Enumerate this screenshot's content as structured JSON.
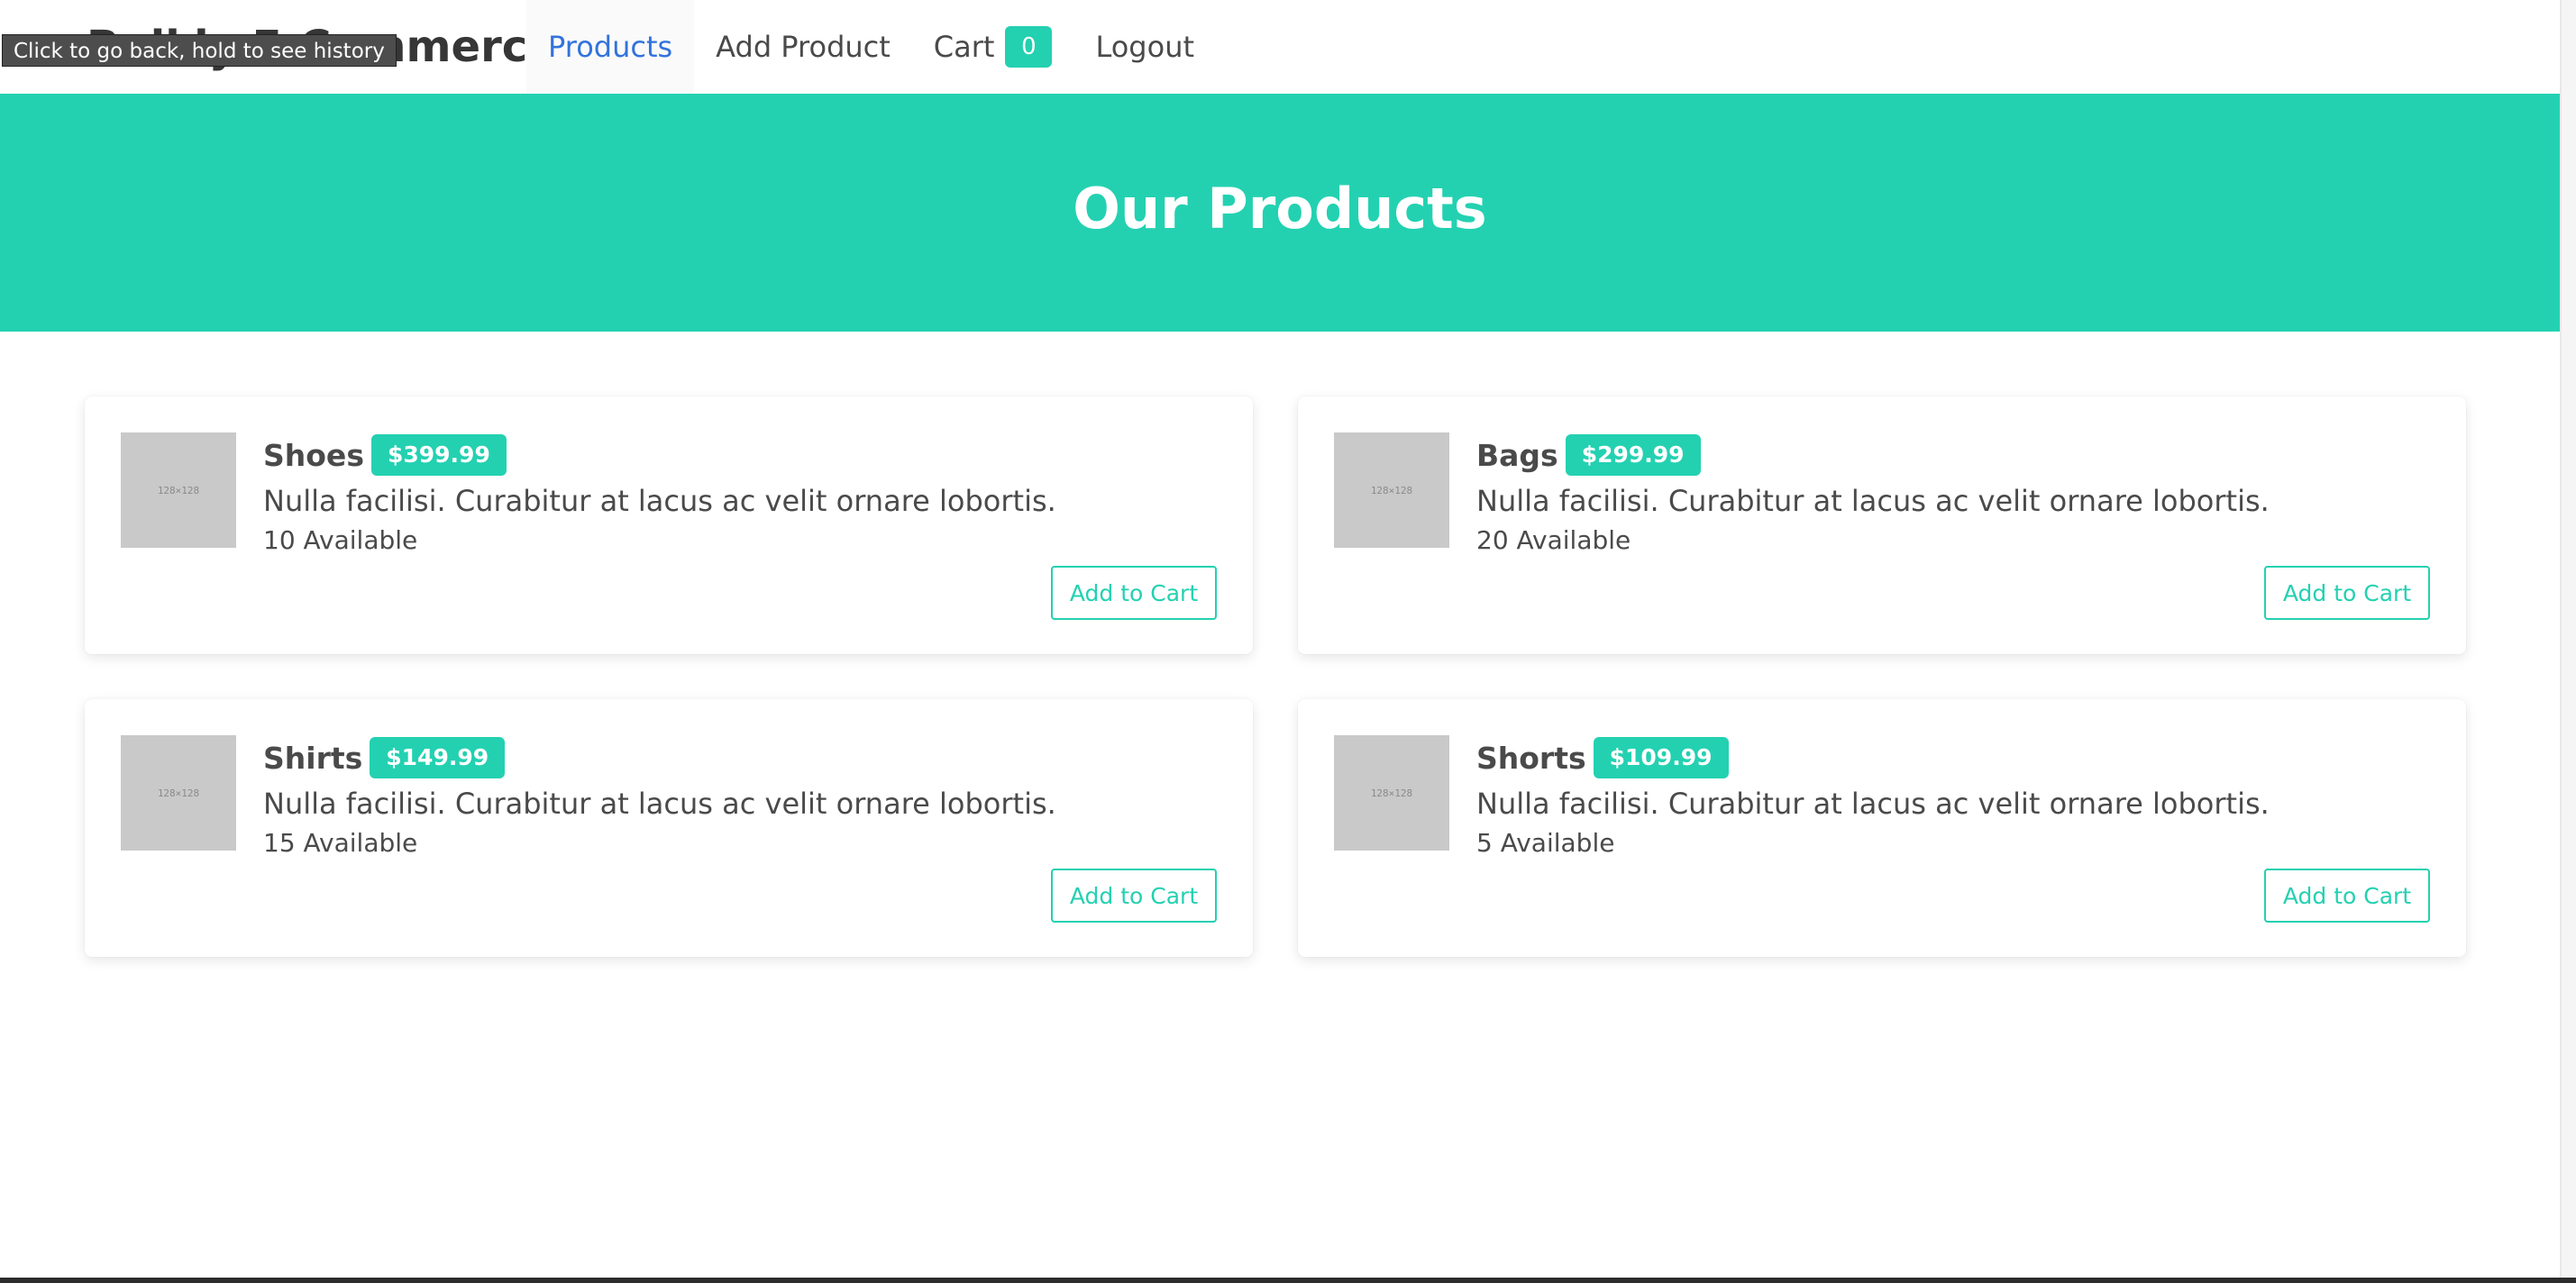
{
  "tooltip": "Click to go back, hold to see history",
  "navbar": {
    "brand": "Bulkly E-Commerce",
    "items": [
      {
        "label": "Products"
      },
      {
        "label": "Add Product"
      },
      {
        "label": "Cart",
        "badge": "0"
      },
      {
        "label": "Logout"
      }
    ]
  },
  "hero": {
    "title": "Our Products"
  },
  "products": [
    {
      "name": "Shoes",
      "price": "$399.99",
      "description": "Nulla facilisi. Curabitur at lacus ac velit ornare lobortis.",
      "stock": "10 Available",
      "image_label": "128×128",
      "button": "Add to Cart"
    },
    {
      "name": "Bags",
      "price": "$299.99",
      "description": "Nulla facilisi. Curabitur at lacus ac velit ornare lobortis.",
      "stock": "20 Available",
      "image_label": "128×128",
      "button": "Add to Cart"
    },
    {
      "name": "Shirts",
      "price": "$149.99",
      "description": "Nulla facilisi. Curabitur at lacus ac velit ornare lobortis.",
      "stock": "15 Available",
      "image_label": "128×128",
      "button": "Add to Cart"
    },
    {
      "name": "Shorts",
      "price": "$109.99",
      "description": "Nulla facilisi. Curabitur at lacus ac velit ornare lobortis.",
      "stock": "5 Available",
      "image_label": "128×128",
      "button": "Add to Cart"
    }
  ],
  "colors": {
    "accent": "#23d1b1",
    "active_link": "#3273dc",
    "text": "#4a4a4a"
  }
}
